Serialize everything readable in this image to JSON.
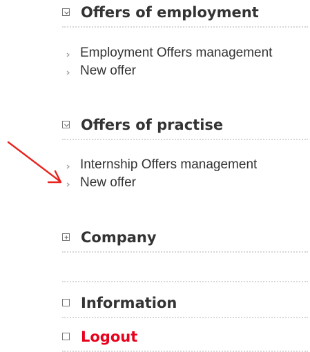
{
  "sections": [
    {
      "title": "Offers of employment",
      "state": "expanded",
      "items": [
        "Employment Offers management",
        "New offer"
      ]
    },
    {
      "title": "Offers of practise",
      "state": "expanded",
      "items": [
        "Internship Offers management",
        "New offer"
      ]
    },
    {
      "title": "Company",
      "state": "collapsed",
      "items": []
    },
    {
      "title": "Information",
      "state": "empty"
    },
    {
      "title": "Logout",
      "state": "empty",
      "color": "#e8001c"
    }
  ],
  "annotation": {
    "arrow_color": "#e8231f"
  },
  "colors": {
    "text": "#333333",
    "logout": "#e8001c",
    "divider": "#d8d8d8"
  }
}
